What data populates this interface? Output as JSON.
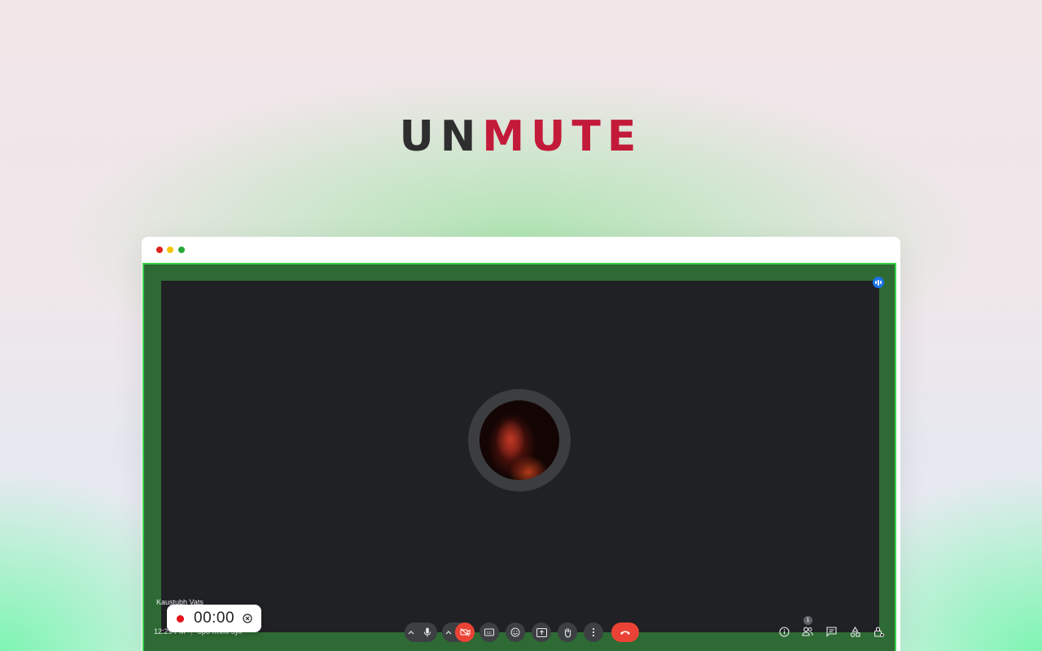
{
  "brand": {
    "logo_part1": "UN",
    "logo_part2": "MUTE",
    "colors": {
      "dark": "#2e2e2f",
      "accent": "#c41a3a"
    }
  },
  "window": {
    "traffic_lights": [
      "close",
      "minimize",
      "maximize"
    ],
    "traffic_light_colors": [
      "#e0221c",
      "#f5c400",
      "#27a73a"
    ]
  },
  "meeting": {
    "participant_name": "Kaustubh Vats",
    "time": "12:29 PM",
    "meeting_code": "opo-rmmi-syk",
    "info_separator": "|",
    "participants_count": "1",
    "accent_border": "#38d14b",
    "tile_background": "#202124"
  },
  "controls": {
    "icons": [
      "chevron-up-icon",
      "microphone-icon",
      "chevron-up-icon",
      "camera-off-icon",
      "captions-icon",
      "emoji-icon",
      "present-screen-icon",
      "raise-hand-icon",
      "more-options-icon",
      "end-call-icon"
    ],
    "right_icons": [
      "info-icon",
      "people-icon",
      "chat-icon",
      "activities-icon",
      "host-controls-icon"
    ]
  },
  "recorder": {
    "timer": "00:00",
    "status_color": "#e4141a"
  }
}
